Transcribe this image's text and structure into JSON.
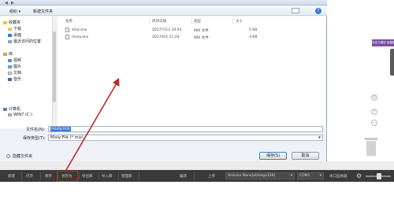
{
  "dialog": {
    "toolbar": {
      "organize": "组织 ▾",
      "new_folder": "新建文件夹"
    },
    "nav": {
      "favorites": "收藏夹",
      "favorites_items": [
        "下载",
        "桌面",
        "最近访问的位置"
      ],
      "libraries": "库",
      "library_items": [
        "视频",
        "图片",
        "文档",
        "音乐"
      ],
      "computer": "计算机",
      "computer_items": [
        "WIN7 (C:)"
      ]
    },
    "columns": {
      "name": "名称",
      "modified": "修改日期",
      "type": "类型",
      "size": "大小"
    },
    "files": [
      {
        "name": "shot.mix",
        "modified": "2017/7/12 10:43",
        "type": "MIX 文件",
        "size": "5 KB"
      },
      {
        "name": "mixly.mix",
        "modified": "2017/6/1 11:24",
        "type": "MIX 文件",
        "size": "3 KB"
      }
    ],
    "filename_label": "文件名(N):",
    "filename_value": "mixly.mix",
    "savetype_label": "保存类型(T):",
    "savetype_value": "Mixly File (*.mix)",
    "hide_folders": "隐藏文件夹",
    "save_button": "保存(S)",
    "cancel_button": "取消"
  },
  "side_tab": {
    "label": "自定义模块  创建模块",
    "color": "#7a4fa0"
  },
  "bottombar": {
    "items": [
      "新建",
      "打开",
      "保存",
      "另存为",
      "导出库",
      "导入库",
      "管理库",
      "编译",
      "上传"
    ],
    "board": "Arduino Nano[atmega328]",
    "port": "COM1",
    "monitor": "串口监视器"
  },
  "colors": {
    "highlight": "#d42020",
    "arrow": "#c0282b",
    "bottombar": "#3a3a3a"
  }
}
